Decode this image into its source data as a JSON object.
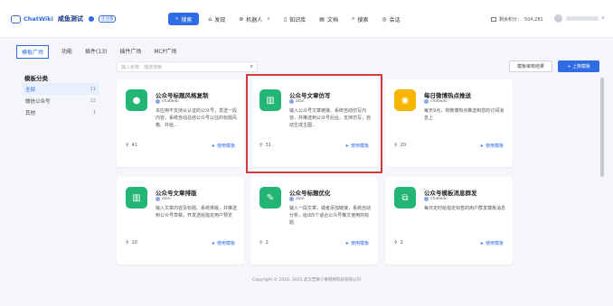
{
  "header": {
    "brand": "ChatWiki",
    "app_name": "咸鱼测试",
    "badge": "企业版",
    "nav": [
      {
        "label": "搜索",
        "icon": "search-icon",
        "active": true
      },
      {
        "label": "发现",
        "icon": "discover-icon"
      },
      {
        "label": "机器人",
        "icon": "robot-icon",
        "dropdown": true
      },
      {
        "label": "知识库",
        "icon": "library-icon"
      },
      {
        "label": "文档",
        "icon": "document-icon"
      },
      {
        "label": "搜索",
        "icon": "search-icon"
      },
      {
        "label": "会话",
        "icon": "chat-icon"
      }
    ],
    "account": {
      "label": "剩余积分：",
      "value": "504,281"
    }
  },
  "tabs": [
    {
      "label": "模板广场",
      "active": true
    },
    {
      "label": "功能"
    },
    {
      "label": "插件(13)"
    },
    {
      "label": "插件广场"
    },
    {
      "label": "MCP广场"
    }
  ],
  "sidebar": {
    "title": "模板分类",
    "items": [
      {
        "label": "全部",
        "count": "11",
        "active": true
      },
      {
        "label": "微信公众号",
        "count": "12"
      },
      {
        "label": "其他",
        "count": "1"
      }
    ]
  },
  "search": {
    "placeholder": "输入名称、描述搜索"
  },
  "buttons": {
    "review": "模板审核结果",
    "upload": "+ 上架模板"
  },
  "cards": [
    {
      "title": "公众号标题风格复制",
      "author": "chatwiki",
      "desc": "本应用不支持从认证的公众号，发送一段内容，系统自动总结公众号以往的标题风格、并给...",
      "uses": "41",
      "use_label": "使用模板",
      "color": "#22b573",
      "icon": "chat-bubble-icon"
    },
    {
      "title": "公众号文章仿写",
      "author": "alan",
      "desc": "输入公众号文章链接、系统自动仿写内容，并推送到公众号后台。支持仿写，自动生成主图...",
      "uses": "31",
      "use_label": "使用模板",
      "color": "#22b573",
      "icon": "book-icon"
    },
    {
      "title": "每日微博热点推送",
      "author": "chatwiki",
      "desc": "每天9点，将微博热点推送到您的订阅消息上",
      "uses": "20",
      "use_label": "使用模板",
      "color": "#f5b400",
      "icon": "weibo-icon"
    },
    {
      "title": "公众号文章排版",
      "author": "alan",
      "desc": "输入文章内容及标题、系统排版，并推送到公众号草稿，开发送给指定用户预览",
      "uses": "10",
      "use_label": "使用模板",
      "color": "#22b573",
      "icon": "book-icon"
    },
    {
      "title": "公众号标题优化",
      "author": "alan",
      "desc": "输入一段文章，或者添加链接，系统自动分析，给出5个适合公众号推文使用的标题",
      "uses": "2",
      "use_label": "使用模板",
      "color": "#22b573",
      "icon": "clipboard-icon"
    },
    {
      "title": "公众号模板消息群发",
      "author": "chatwiki",
      "desc": "每日定时给指定标签的用户群发模板消息",
      "uses": "2",
      "use_label": "使用模板",
      "color": "#22b573",
      "icon": "network-icon"
    }
  ],
  "footer": "Copyright © 2016- 2025 武汉芝麻小事网络科技有限公司"
}
